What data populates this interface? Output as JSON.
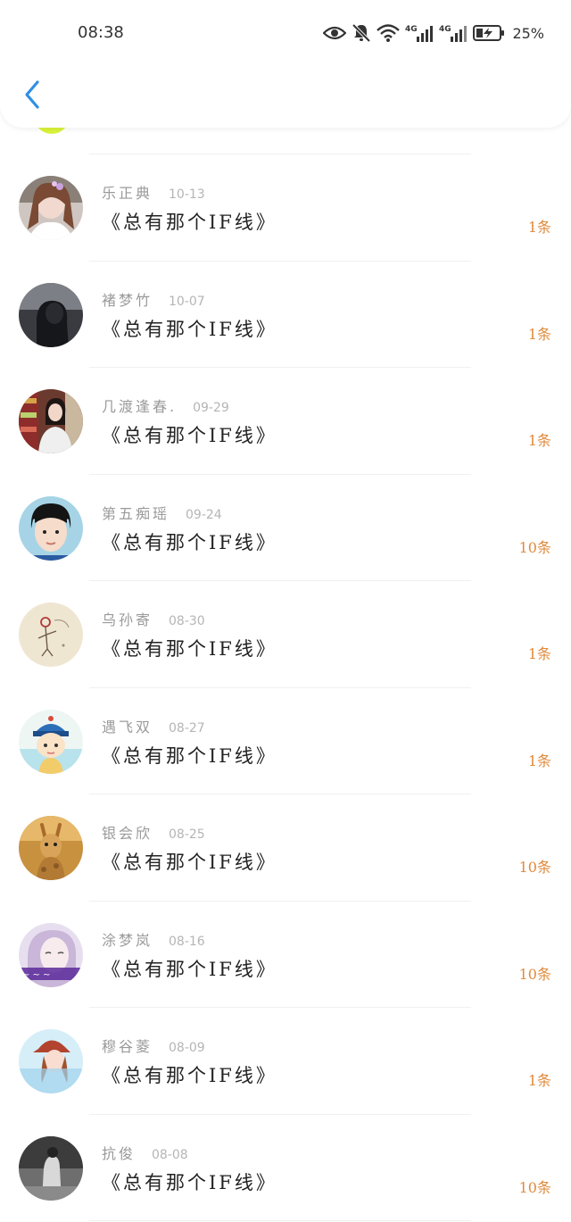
{
  "status_bar": {
    "time": "08:38",
    "battery": "25%",
    "icons": [
      "eye-icon",
      "bell-off-icon",
      "wifi-icon",
      "signal-4g-icon",
      "signal-4g-icon",
      "battery-charging-icon"
    ]
  },
  "header": {
    "back_icon": "chevron-left-icon",
    "accent": "#2f8fe6"
  },
  "colors": {
    "count": "#e08a3c",
    "name": "#9a9a9a",
    "date": "#b5b5b5",
    "title": "#222222"
  },
  "messages": [
    {
      "name": "乐正典",
      "date": "10-13",
      "title": "《总有那个IF线》",
      "count": "1条",
      "avatar": "avatar-photo-girl-flower-crown"
    },
    {
      "name": "褚梦竹",
      "date": "10-07",
      "title": "《总有那个IF线》",
      "count": "1条",
      "avatar": "avatar-photo-dark-silhouette"
    },
    {
      "name": "几渡逢春.",
      "date": "09-29",
      "title": "《总有那个IF线》",
      "count": "1条",
      "avatar": "avatar-photo-girl-store"
    },
    {
      "name": "第五痴瑶",
      "date": "09-24",
      "title": "《总有那个IF线》",
      "count": "10条",
      "avatar": "avatar-photo-boy"
    },
    {
      "name": "乌孙寄",
      "date": "08-30",
      "title": "《总有那个IF线》",
      "count": "1条",
      "avatar": "avatar-sketch-drawing"
    },
    {
      "name": "遇飞双",
      "date": "08-27",
      "title": "《总有那个IF线》",
      "count": "1条",
      "avatar": "avatar-cartoon-boy-hat"
    },
    {
      "name": "银会欣",
      "date": "08-25",
      "title": "《总有那个IF线》",
      "count": "10条",
      "avatar": "avatar-photo-giraffe"
    },
    {
      "name": "涂梦岚",
      "date": "08-16",
      "title": "《总有那个IF线》",
      "count": "10条",
      "avatar": "avatar-photo-girl-purple"
    },
    {
      "name": "穆谷菱",
      "date": "08-09",
      "title": "《总有那个IF线》",
      "count": "1条",
      "avatar": "avatar-photo-girl-hat"
    },
    {
      "name": "抗俊",
      "date": "08-08",
      "title": "《总有那个IF线》",
      "count": "10条",
      "avatar": "avatar-photo-bw-figure"
    }
  ]
}
